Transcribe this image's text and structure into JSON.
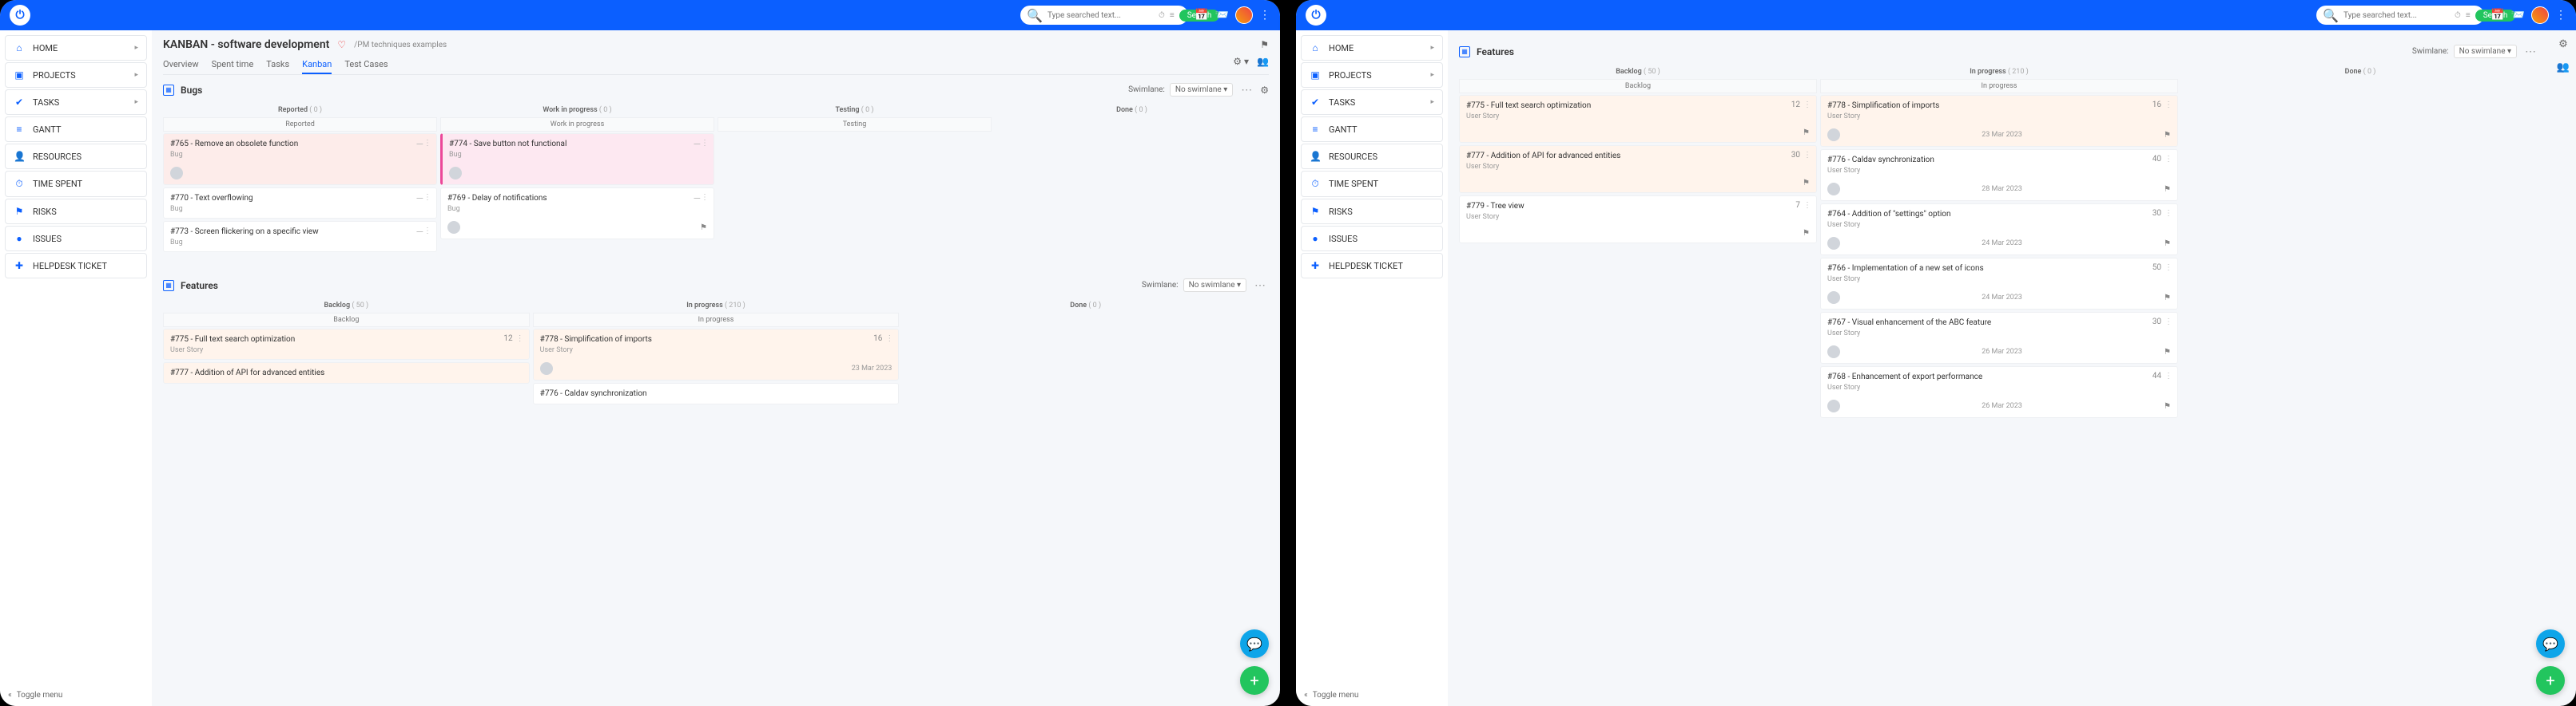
{
  "topbar": {
    "search_placeholder": "Type searched text...",
    "search_btn": "Search"
  },
  "nav": {
    "items": [
      {
        "icon": "⌂",
        "label": "HOME",
        "expandable": true
      },
      {
        "icon": "▣",
        "label": "PROJECTS",
        "expandable": true
      },
      {
        "icon": "✔",
        "label": "TASKS",
        "expandable": true
      },
      {
        "icon": "≡",
        "label": "GANTT",
        "expandable": false
      },
      {
        "icon": "👤",
        "label": "RESOURCES",
        "expandable": false
      },
      {
        "icon": "⏱",
        "label": "TIME SPENT",
        "expandable": false
      },
      {
        "icon": "⚑",
        "label": "RISKS",
        "expandable": false
      },
      {
        "icon": "●",
        "label": "ISSUES",
        "expandable": false
      },
      {
        "icon": "✚",
        "label": "HELPDESK TICKET",
        "expandable": false
      }
    ]
  },
  "page": {
    "title": "KANBAN - software development",
    "breadcrumb": "/PM techniques examples",
    "tabs": [
      "Overview",
      "Spent time",
      "Tasks",
      "Kanban",
      "Test Cases"
    ],
    "active_tab": 3
  },
  "swimlane": {
    "label": "Swimlane:",
    "value": "No swimlane"
  },
  "sections": {
    "bugs": {
      "title": "Bugs",
      "columns": [
        {
          "name": "Reported",
          "count": "( 0 )",
          "sub": "Reported"
        },
        {
          "name": "Work in progress",
          "count": "( 0 )",
          "sub": "Work in progress"
        },
        {
          "name": "Testing",
          "count": "( 0 )",
          "sub": "Testing"
        },
        {
          "name": "Done",
          "count": "( 0 )",
          "sub": ""
        }
      ],
      "cards": {
        "0": [
          {
            "title": "#765 - Remove an obsolete function",
            "type": "Bug",
            "cls": "red"
          },
          {
            "title": "#770 - Text overflowing",
            "type": "Bug",
            "cls": ""
          },
          {
            "title": "#773 - Screen flickering on a specific view",
            "type": "Bug",
            "cls": ""
          }
        ],
        "1": [
          {
            "title": "#774 - Save button not functional",
            "type": "Bug",
            "cls": "pink"
          },
          {
            "title": "#769 - Delay of notifications",
            "type": "Bug",
            "cls": ""
          }
        ]
      }
    },
    "features": {
      "title": "Features",
      "columns": [
        {
          "name": "Backlog",
          "count": "( 50 )",
          "sub": "Backlog"
        },
        {
          "name": "In progress",
          "count": "( 210 )",
          "sub": "In progress"
        },
        {
          "name": "Done",
          "count": "( 0 )",
          "sub": ""
        }
      ],
      "cards_left": {
        "0": [
          {
            "title": "#775 - Full text search optimization",
            "type": "User Story",
            "num": "12",
            "cls": "peach"
          },
          {
            "title": "#777 - Addition of API for advanced entities",
            "type": "User Story",
            "num": "",
            "cls": "peach"
          }
        ],
        "1": [
          {
            "title": "#778 - Simplification of imports",
            "type": "User Story",
            "num": "16",
            "cls": "peach",
            "date": "23 Mar 2023"
          },
          {
            "title": "#776 - Caldav synchronization",
            "type": "User Story",
            "num": "",
            "cls": ""
          }
        ]
      },
      "cards_right": {
        "0": [
          {
            "title": "#775 - Full text search optimization",
            "type": "User Story",
            "num": "12",
            "cls": "peach"
          },
          {
            "title": "#777 - Addition of API for advanced entities",
            "type": "User Story",
            "num": "30",
            "cls": "peach"
          },
          {
            "title": "#779 - Tree view",
            "type": "User Story",
            "num": "7",
            "cls": ""
          }
        ],
        "1": [
          {
            "title": "#778 - Simplification of imports",
            "type": "User Story",
            "num": "16",
            "cls": "peach",
            "date": "23 Mar 2023"
          },
          {
            "title": "#776 - Caldav synchronization",
            "type": "User Story",
            "num": "40",
            "cls": "",
            "date": "28 Mar 2023"
          },
          {
            "title": "#764 - Addition of \"settings\" option",
            "type": "User Story",
            "num": "30",
            "cls": "",
            "date": "24 Mar 2023"
          },
          {
            "title": "#766 - Implementation of a new set of icons",
            "type": "User Story",
            "num": "50",
            "cls": "",
            "date": "24 Mar 2023"
          },
          {
            "title": "#767 - Visual enhancement of the ABC feature",
            "type": "User Story",
            "num": "30",
            "cls": "",
            "date": "26 Mar 2023"
          },
          {
            "title": "#768 - Enhancement of export performance",
            "type": "User Story",
            "num": "44",
            "cls": "",
            "date": "26 Mar 2023"
          }
        ]
      }
    }
  },
  "toggle_menu": "Toggle menu"
}
